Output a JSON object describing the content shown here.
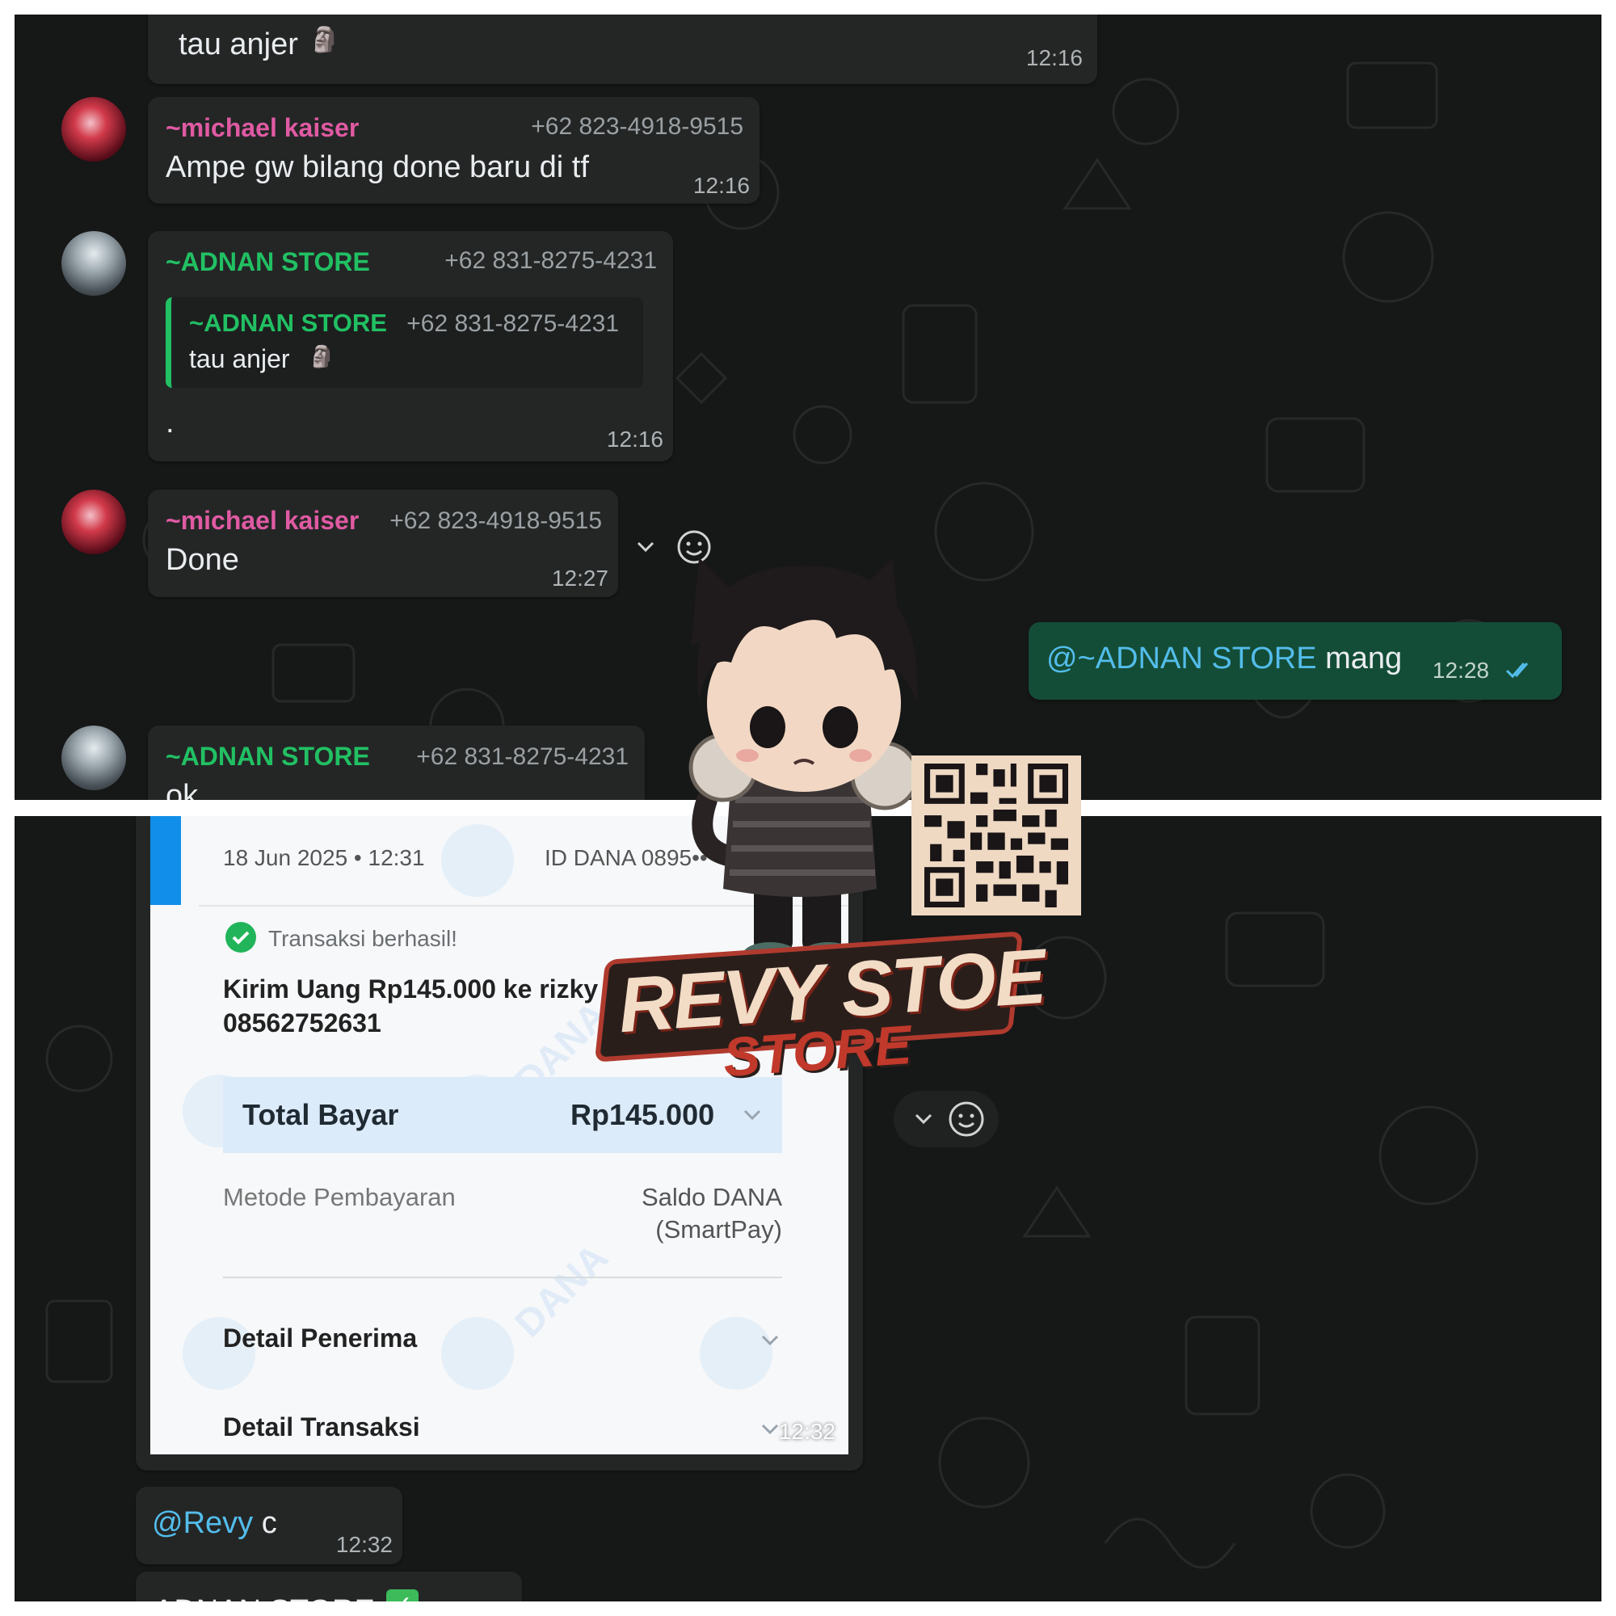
{
  "top": {
    "m0": {
      "text": "tau anjer",
      "time": "12:16"
    },
    "m1": {
      "sender": "~michael kaiser",
      "phone": "+62 823-4918-9515",
      "text": "Ampe gw bilang done baru di tf",
      "time": "12:16"
    },
    "m2": {
      "sender": "~ADNAN STORE",
      "phone": "+62 831-8275-4231",
      "quote": {
        "sender": "~ADNAN STORE",
        "phone": "+62 831-8275-4231",
        "text": "tau anjer"
      },
      "text": ".",
      "time": "12:16"
    },
    "m3": {
      "sender": "~michael kaiser",
      "phone": "+62 823-4918-9515",
      "text": "Done",
      "time": "12:27"
    },
    "m4": {
      "mention": "@~ADNAN STORE",
      "text": "mang",
      "time": "12:28"
    },
    "m5": {
      "sender": "~ADNAN STORE",
      "phone": "+62 831-8275-4231",
      "text": "ok"
    }
  },
  "receipt": {
    "date": "18 Jun 2025 • 12:31",
    "id": "ID DANA 0895••",
    "status": "Transaksi berhasil!",
    "desc_line1": "Kirim Uang Rp145.000 ke rizky",
    "desc_line2": "08562752631",
    "total_label": "Total Bayar",
    "total_value": "Rp145.000",
    "method_label": "Metode Pembayaran",
    "method_value_line1": "Saldo DANA",
    "method_value_line2": "(SmartPay)",
    "detail_penerima": "Detail Penerima",
    "detail_transaksi": "Detail Transaksi",
    "watermark": "DANA",
    "time": "12:32"
  },
  "bottom": {
    "m1": {
      "mention": "@Revy",
      "text": "c",
      "time": "12:32"
    },
    "m2": {
      "text": "ADNAN STORE"
    }
  },
  "logo": {
    "line1": "REVY STOE",
    "line2": "STORE"
  },
  "colors": {
    "bg": "#161717",
    "bubble_in": "#242626",
    "bubble_out": "#144d37",
    "green": "#21c063",
    "pink": "#e05aa3",
    "mention": "#53bdeb"
  }
}
